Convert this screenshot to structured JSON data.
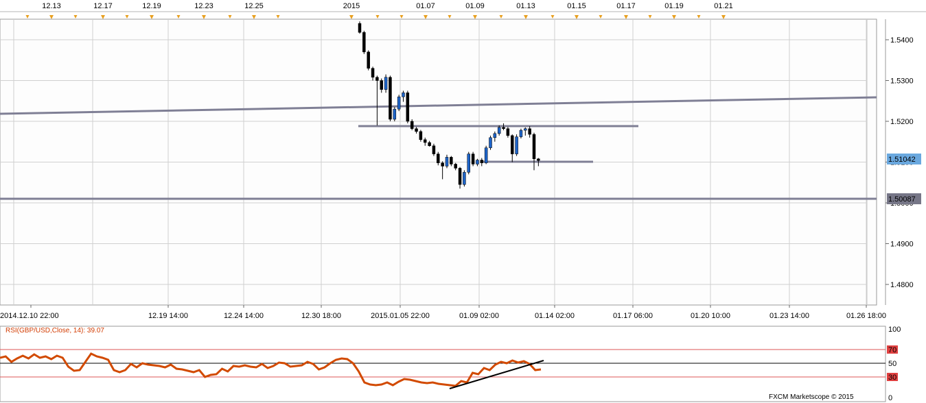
{
  "chart_data": [
    {
      "type": "candlestick",
      "symbol": "GBP/USD",
      "colors": {
        "bull": "#1e64c8",
        "bear": "#000000",
        "level_line": "#7f7f95",
        "grid": "#c8c8c8",
        "current_price_bg": "#6aa8df",
        "line_price_bg": "#767687"
      },
      "y_ticks": [
        "1.5400",
        "1.5300",
        "1.5200",
        "1.5100",
        "1.5000",
        "1.4900",
        "1.4800"
      ],
      "x_ticks_bottom": [
        "2014.12.10 22:00",
        "12.19 14:00",
        "12.24 14:00",
        "12.30 18:00",
        "2015.01.05 22:00",
        "01.09 02:00",
        "01.14 02:00",
        "01.17 06:00",
        "01.20 10:00",
        "01.23 14:00",
        "01.26 18:00"
      ],
      "x_ticks_top": [
        "12.13",
        "12.17",
        "12.19",
        "12.23",
        "12.25",
        "2015",
        "01.07",
        "01.09",
        "01.13",
        "01.15",
        "01.17",
        "01.19",
        "01.21"
      ],
      "current_price": "1.51042",
      "line_price": "1.50087",
      "candles": [
        {
          "o": 1.544,
          "h": 1.5445,
          "l": 1.5415,
          "c": 1.5418
        },
        {
          "o": 1.5418,
          "h": 1.5422,
          "l": 1.5365,
          "c": 1.537
        },
        {
          "o": 1.537,
          "h": 1.5374,
          "l": 1.5325,
          "c": 1.533
        },
        {
          "o": 1.533,
          "h": 1.5334,
          "l": 1.53,
          "c": 1.5308
        },
        {
          "o": 1.5308,
          "h": 1.5312,
          "l": 1.519,
          "c": 1.53
        },
        {
          "o": 1.53,
          "h": 1.5305,
          "l": 1.527,
          "c": 1.5278
        },
        {
          "o": 1.5278,
          "h": 1.5315,
          "l": 1.527,
          "c": 1.5308
        },
        {
          "o": 1.5308,
          "h": 1.5312,
          "l": 1.52,
          "c": 1.5205
        },
        {
          "o": 1.5205,
          "h": 1.5235,
          "l": 1.52,
          "c": 1.523
        },
        {
          "o": 1.523,
          "h": 1.5265,
          "l": 1.5225,
          "c": 1.526
        },
        {
          "o": 1.526,
          "h": 1.5275,
          "l": 1.5248,
          "c": 1.527
        },
        {
          "o": 1.527,
          "h": 1.5275,
          "l": 1.5195,
          "c": 1.52
        },
        {
          "o": 1.52,
          "h": 1.5205,
          "l": 1.5178,
          "c": 1.5182
        },
        {
          "o": 1.5182,
          "h": 1.5186,
          "l": 1.517,
          "c": 1.5175
        },
        {
          "o": 1.5175,
          "h": 1.5179,
          "l": 1.515,
          "c": 1.5155
        },
        {
          "o": 1.5155,
          "h": 1.516,
          "l": 1.514,
          "c": 1.5148
        },
        {
          "o": 1.5148,
          "h": 1.5152,
          "l": 1.5138,
          "c": 1.514
        },
        {
          "o": 1.514,
          "h": 1.5145,
          "l": 1.5115,
          "c": 1.512
        },
        {
          "o": 1.512,
          "h": 1.5125,
          "l": 1.5092,
          "c": 1.5098
        },
        {
          "o": 1.5098,
          "h": 1.5102,
          "l": 1.5058,
          "c": 1.509
        },
        {
          "o": 1.509,
          "h": 1.5118,
          "l": 1.5085,
          "c": 1.5112
        },
        {
          "o": 1.5112,
          "h": 1.5115,
          "l": 1.509,
          "c": 1.5095
        },
        {
          "o": 1.5095,
          "h": 1.5098,
          "l": 1.508,
          "c": 1.5085
        },
        {
          "o": 1.5085,
          "h": 1.5088,
          "l": 1.5035,
          "c": 1.5045
        },
        {
          "o": 1.5045,
          "h": 1.508,
          "l": 1.504,
          "c": 1.5075
        },
        {
          "o": 1.5075,
          "h": 1.5125,
          "l": 1.507,
          "c": 1.512
        },
        {
          "o": 1.512,
          "h": 1.5125,
          "l": 1.509,
          "c": 1.5095
        },
        {
          "o": 1.5095,
          "h": 1.5108,
          "l": 1.509,
          "c": 1.5105
        },
        {
          "o": 1.5105,
          "h": 1.511,
          "l": 1.509,
          "c": 1.5098
        },
        {
          "o": 1.5098,
          "h": 1.514,
          "l": 1.5095,
          "c": 1.5135
        },
        {
          "o": 1.5135,
          "h": 1.5165,
          "l": 1.513,
          "c": 1.516
        },
        {
          "o": 1.516,
          "h": 1.5175,
          "l": 1.515,
          "c": 1.517
        },
        {
          "o": 1.517,
          "h": 1.519,
          "l": 1.5165,
          "c": 1.5185
        },
        {
          "o": 1.5185,
          "h": 1.5195,
          "l": 1.5178,
          "c": 1.5182
        },
        {
          "o": 1.5182,
          "h": 1.5186,
          "l": 1.516,
          "c": 1.5165
        },
        {
          "o": 1.5165,
          "h": 1.5168,
          "l": 1.51,
          "c": 1.512
        },
        {
          "o": 1.512,
          "h": 1.5168,
          "l": 1.5115,
          "c": 1.5162
        },
        {
          "o": 1.5162,
          "h": 1.5182,
          "l": 1.5158,
          "c": 1.5178
        },
        {
          "o": 1.5178,
          "h": 1.5185,
          "l": 1.5165,
          "c": 1.5182
        },
        {
          "o": 1.5182,
          "h": 1.5188,
          "l": 1.516,
          "c": 1.5168
        },
        {
          "o": 1.5168,
          "h": 1.5172,
          "l": 1.508,
          "c": 1.5108
        },
        {
          "o": 1.5108,
          "h": 1.511,
          "l": 1.509,
          "c": 1.5104
        }
      ]
    },
    {
      "type": "line",
      "title": "RSI(GBP/USD,Close, 14): 39.07",
      "y_ticks": [
        "100",
        "70",
        "50",
        "30",
        "0"
      ],
      "series": [
        {
          "name": "RSI",
          "values": [
            58,
            60,
            52,
            57,
            61,
            57,
            63,
            58,
            60,
            56,
            61,
            58,
            45,
            39,
            40,
            52,
            64,
            60,
            58,
            55,
            40,
            37,
            40,
            49,
            44,
            50,
            48,
            47,
            46,
            44,
            48,
            42,
            41,
            39,
            37,
            40,
            30,
            33,
            34,
            42,
            38,
            46,
            45,
            47,
            45,
            44,
            49,
            43,
            46,
            51,
            50,
            45,
            46,
            47,
            52,
            49,
            41,
            44,
            50,
            55,
            57,
            56,
            50,
            38,
            22,
            19,
            18,
            19,
            22,
            18,
            23,
            27,
            26,
            24,
            22,
            21,
            22,
            20,
            19,
            18,
            17,
            24,
            22,
            36,
            34,
            43,
            40,
            48,
            52,
            50,
            54,
            51,
            53,
            49,
            40,
            41
          ]
        }
      ]
    }
  ],
  "footer": "FXCM Marketscope © 2015"
}
